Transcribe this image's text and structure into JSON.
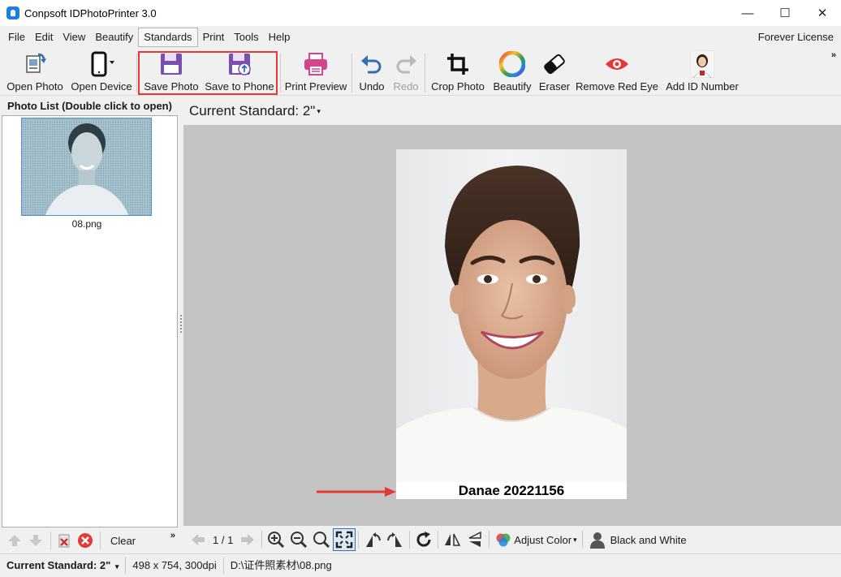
{
  "window": {
    "title": "Conpsoft IDPhotoPrinter 3.0",
    "minimize": "—",
    "maximize": "☐",
    "close": "✕"
  },
  "menu": {
    "items": [
      "File",
      "Edit",
      "View",
      "Beautify",
      "Standards",
      "Print",
      "Tools",
      "Help"
    ],
    "active": "Standards",
    "license": "Forever License"
  },
  "toolbar": {
    "open_photo": "Open Photo",
    "open_device": "Open Device",
    "save_photo": "Save Photo",
    "save_to_phone": "Save to Phone",
    "print_preview": "Print Preview",
    "undo": "Undo",
    "redo": "Redo",
    "crop_photo": "Crop Photo",
    "beautify": "Beautify",
    "eraser": "Eraser",
    "remove_red_eye": "Remove Red Eye",
    "add_id_number": "Add ID Number",
    "overflow": "»"
  },
  "photo_list": {
    "header": "Photo List (Double click to open)",
    "items": [
      {
        "filename": "08.png"
      }
    ],
    "clear_label": "Clear",
    "overflow": "»"
  },
  "main": {
    "current_standard": "Current Standard: 2\"",
    "caret": "▾",
    "photo_name_text": "Danae 20221156"
  },
  "bottom_toolbar": {
    "page": "1 / 1",
    "adjust_color": "Adjust Color",
    "black_and_white": "Black and White"
  },
  "status": {
    "standard": "Current Standard: 2\"",
    "dimensions": "498 x 754, 300dpi",
    "path": "D:\\证件照素材\\08.png"
  },
  "colors": {
    "accent_red": "#e53935",
    "save_purple": "#7b4fb0",
    "print_pink": "#d4458c",
    "undo_blue": "#2f6fb5",
    "canvas_gray": "#c3c3c3"
  }
}
